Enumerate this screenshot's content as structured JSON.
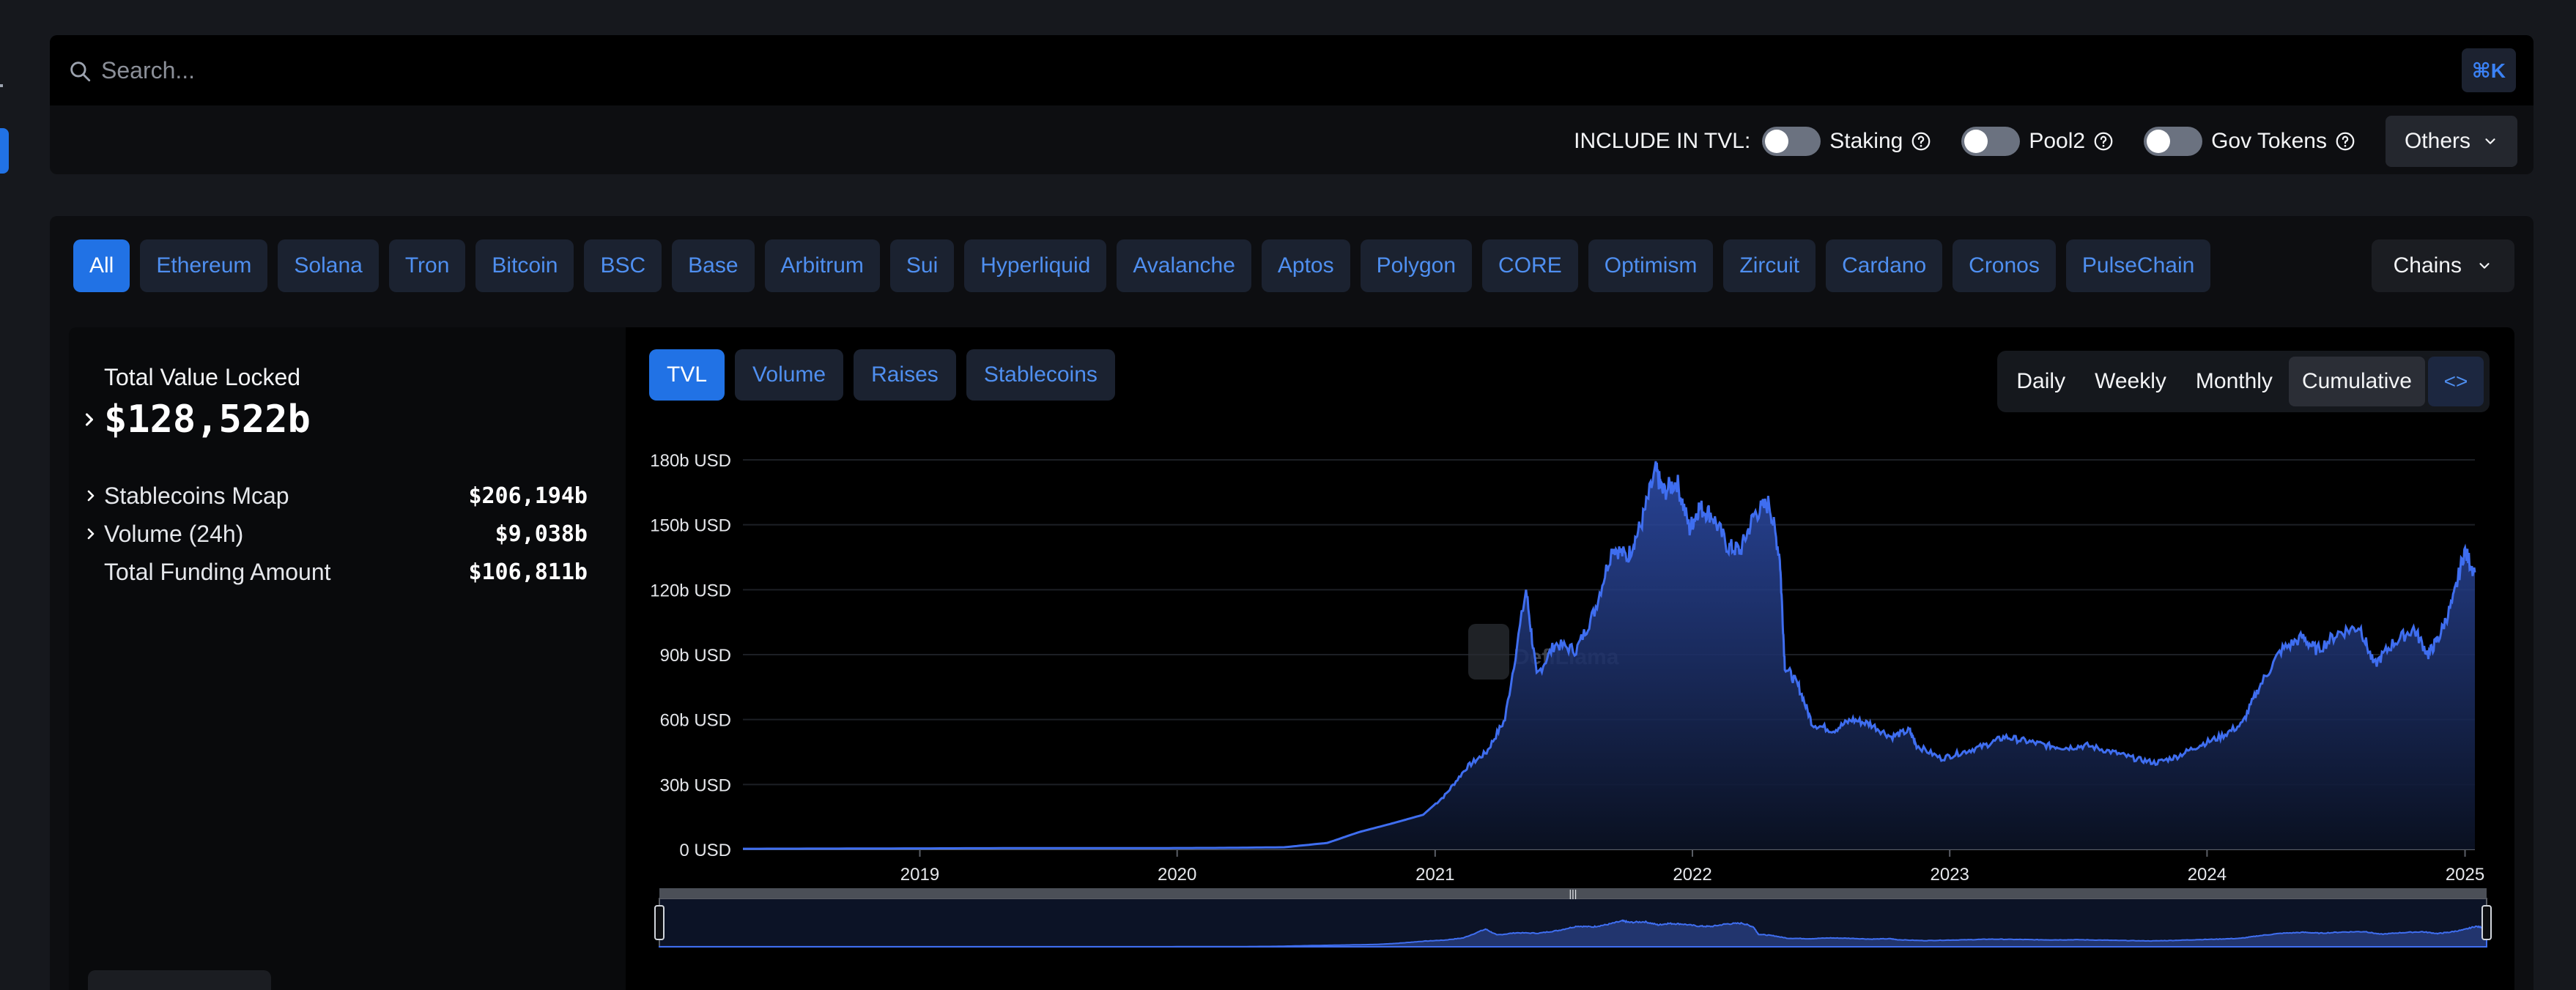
{
  "search": {
    "placeholder": "Search...",
    "shortcut": "⌘K"
  },
  "tvl_settings": {
    "label": "INCLUDE IN TVL:",
    "toggles": [
      {
        "label": "Staking",
        "on": false
      },
      {
        "label": "Pool2",
        "on": false
      },
      {
        "label": "Gov Tokens",
        "on": false
      }
    ],
    "others_label": "Others"
  },
  "chains": {
    "items": [
      "All",
      "Ethereum",
      "Solana",
      "Tron",
      "Bitcoin",
      "BSC",
      "Base",
      "Arbitrum",
      "Sui",
      "Hyperliquid",
      "Avalanche",
      "Aptos",
      "Polygon",
      "CORE",
      "Optimism",
      "Zircuit",
      "Cardano",
      "Cronos",
      "PulseChain"
    ],
    "active": "All",
    "dropdown_label": "Chains"
  },
  "stats": {
    "tvl_title": "Total Value Locked",
    "tvl_value": "$128,522b",
    "rows": [
      {
        "label": "Stablecoins Mcap",
        "value": "$206,194b"
      },
      {
        "label": "Volume (24h)",
        "value": "$9,038b"
      },
      {
        "label": "Total Funding Amount",
        "value": "$106,811b"
      }
    ]
  },
  "chart_tabs": {
    "metrics": [
      "TVL",
      "Volume",
      "Raises",
      "Stablecoins"
    ],
    "active_metric": "TVL",
    "periods": [
      "Daily",
      "Weekly",
      "Monthly",
      "Cumulative"
    ],
    "selected_period": "Cumulative",
    "embed_label": "<>"
  },
  "watermark": "DefiLlama",
  "colors": {
    "accent": "#2172e5",
    "line": "#3f6ef0",
    "chip_text": "#4f8ff0"
  },
  "chart_data": {
    "type": "area",
    "y_unit": "USD",
    "ylim": [
      0,
      180
    ],
    "y_ticks": [
      "0 USD",
      "30b USD",
      "60b USD",
      "90b USD",
      "120b USD",
      "150b USD",
      "180b USD"
    ],
    "x_ticks": [
      "2019",
      "2020",
      "2021",
      "2022",
      "2023",
      "2024",
      "2025"
    ],
    "xlim": [
      "2018-04-25",
      "2025-01-15"
    ],
    "grid": true,
    "series": [
      {
        "values_unit": "billions",
        "x": [
          "2018-04-25",
          "2018-10-01",
          "2019-06-01",
          "2019-12-01",
          "2020-03-01",
          "2020-06-01",
          "2020-08-01",
          "2020-09-15",
          "2020-11-01",
          "2020-12-15",
          "2021-01-15",
          "2021-02-15",
          "2021-03-15",
          "2021-04-10",
          "2021-05-10",
          "2021-05-25",
          "2021-06-20",
          "2021-07-20",
          "2021-08-15",
          "2021-09-10",
          "2021-10-01",
          "2021-10-20",
          "2021-11-10",
          "2021-11-20",
          "2021-12-10",
          "2021-12-28",
          "2022-01-10",
          "2022-01-28",
          "2022-02-20",
          "2022-03-10",
          "2022-03-30",
          "2022-04-20",
          "2022-05-05",
          "2022-05-12",
          "2022-06-01",
          "2022-06-20",
          "2022-07-20",
          "2022-08-15",
          "2022-09-10",
          "2022-10-10",
          "2022-11-05",
          "2022-11-15",
          "2022-12-20",
          "2023-01-20",
          "2023-02-20",
          "2023-03-20",
          "2023-04-20",
          "2023-05-20",
          "2023-06-15",
          "2023-07-15",
          "2023-08-20",
          "2023-09-20",
          "2023-10-20",
          "2023-11-20",
          "2023-12-20",
          "2024-01-20",
          "2024-02-20",
          "2024-03-15",
          "2024-04-15",
          "2024-05-15",
          "2024-06-05",
          "2024-07-05",
          "2024-08-05",
          "2024-08-25",
          "2024-09-20",
          "2024-10-20",
          "2024-11-10",
          "2024-11-25",
          "2024-12-15",
          "2024-12-31",
          "2025-01-15"
        ],
        "values": [
          0.3,
          0.4,
          0.6,
          0.6,
          0.7,
          1.0,
          3.0,
          8.0,
          12.0,
          16.0,
          25.0,
          38.0,
          45.0,
          60.0,
          120.0,
          80.0,
          95.0,
          92.0,
          110.0,
          140.0,
          135.0,
          150.0,
          175.0,
          165.0,
          170.0,
          148.0,
          158.0,
          155.0,
          140.0,
          138.0,
          155.0,
          160.0,
          135.0,
          85.0,
          75.0,
          58.0,
          55.0,
          60.0,
          58.0,
          52.0,
          55.0,
          48.0,
          42.0,
          45.0,
          48.0,
          52.0,
          50.0,
          48.0,
          47.0,
          48.0,
          45.0,
          42.0,
          40.0,
          43.0,
          48.0,
          52.0,
          58.0,
          75.0,
          92.0,
          98.0,
          92.0,
          100.0,
          103.0,
          85.0,
          95.0,
          102.0,
          90.0,
          98.0,
          115.0,
          138.0,
          128.0
        ]
      }
    ]
  }
}
